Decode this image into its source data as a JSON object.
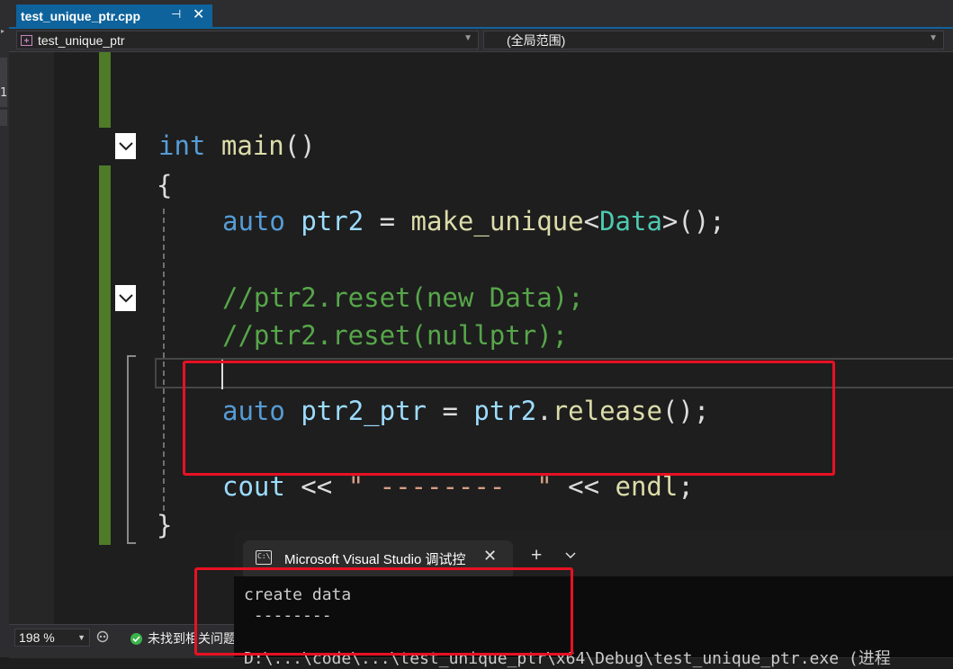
{
  "tab": {
    "title": "test_unique_ptr.cpp",
    "pin_icon": "pin-icon",
    "close_glyph": "✕"
  },
  "left_strip": {
    "number": "1"
  },
  "navbar": {
    "project_scope": "test_unique_ptr",
    "member_scope": "(全局范围)"
  },
  "code": {
    "line_main_kw": "int",
    "line_main_fn": "main",
    "line_main_paren": "()",
    "open_brace": "{",
    "close_brace": "}",
    "line1": {
      "auto": "auto",
      "var": "ptr2",
      "eq": " = ",
      "fn": "make_unique",
      "lt": "<",
      "type": "Data",
      "rest": ">();"
    },
    "comment1": "//ptr2.reset(new Data);",
    "comment2": "//ptr2.reset(nullptr);",
    "line2": {
      "auto": "auto",
      "var": "ptr2_ptr",
      "eq": " = ",
      "var2": "ptr2",
      "dot": ".",
      "fn": "release",
      "rest": "();"
    },
    "line3": {
      "cout": "cout",
      "op1": " << ",
      "str": "\" --------  \"",
      "op2": " << ",
      "endl": "endl",
      "semi": ";"
    }
  },
  "statusbar": {
    "zoom": "198 %",
    "issues": "未找到相关问题"
  },
  "terminal": {
    "title": "Microsoft Visual Studio 调试控",
    "close_glyph": "✕",
    "plus_glyph": "+",
    "chevron_glyph": "⌄",
    "icon_text": "C:\\",
    "line1": "create data",
    "line2": " --------",
    "line3": "D:\\...\\code\\...\\test_unique_ptr\\x64\\Debug\\test_unique_ptr.exe (进程"
  },
  "colors": {
    "accent": "#0e639c",
    "keyword": "#569cd6",
    "function": "#dcdcaa",
    "variable": "#9cdcfe",
    "type": "#4ec9b0",
    "comment": "#57a64a",
    "string": "#d69d85",
    "highlight_box": "#e81123",
    "change_bar": "#4f7a28"
  }
}
